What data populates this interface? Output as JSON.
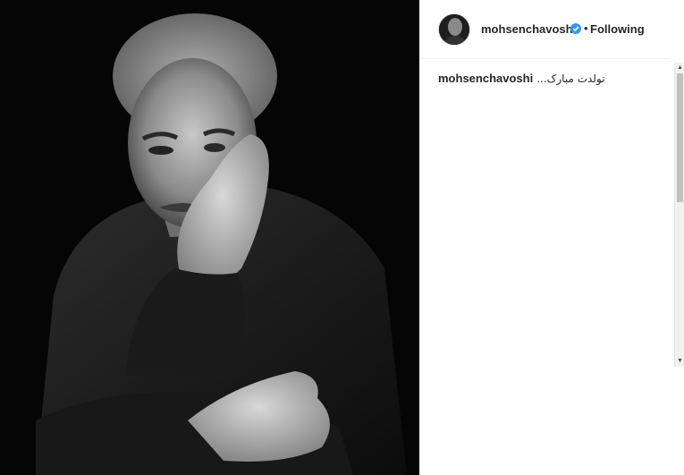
{
  "post": {
    "username": "mohsenchavoshi",
    "dot": "•",
    "follow_label": "Following",
    "caption_user": "mohsenchavoshi",
    "caption_text": "تولدت مبارک..."
  },
  "icons": {
    "verified": "verified-badge-icon",
    "scroll_up": "▲",
    "scroll_down": "▼"
  },
  "colors": {
    "verified": "#3897f0",
    "text": "#262626"
  }
}
